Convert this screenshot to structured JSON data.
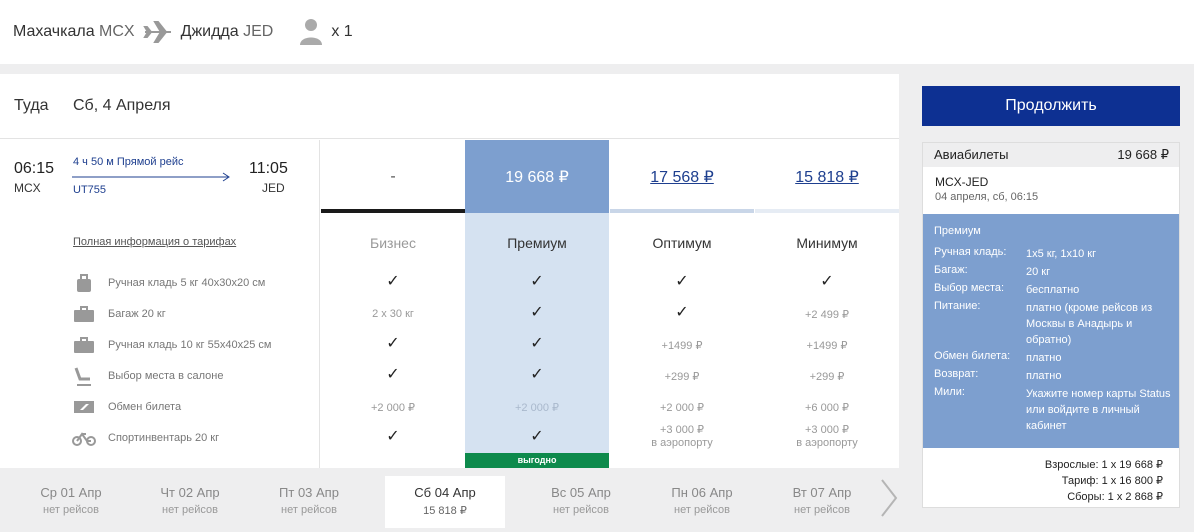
{
  "header": {
    "from_city": "Махачкала",
    "from_code": "MCX",
    "to_city": "Джидда",
    "to_code": "JED",
    "passengers": "x 1"
  },
  "direction": {
    "label": "Туда",
    "date": "Сб, 4 Апреля"
  },
  "flight": {
    "dep_time": "06:15",
    "dep_airport": "MCX",
    "arr_time": "11:05",
    "arr_airport": "JED",
    "duration": "4 ч 50 м  Прямой рейс",
    "number": "UT755"
  },
  "fares": [
    {
      "name": "Бизнес",
      "price": "-"
    },
    {
      "name": "Премиум",
      "price": "19 668 ₽"
    },
    {
      "name": "Оптимум",
      "price": "17 568 ₽"
    },
    {
      "name": "Минимум",
      "price": "15 818 ₽"
    }
  ],
  "full_info_link": "Полная информация о тарифах",
  "features": [
    {
      "label": "Ручная кладь 5 кг 40x30x20 см",
      "icon": "bag-icon",
      "values": [
        "✓",
        "✓",
        "✓",
        "✓"
      ]
    },
    {
      "label": "Багаж 20 кг",
      "icon": "suitcase-icon",
      "values": [
        "2 x 30 кг",
        "✓",
        "✓",
        "+2 499 ₽"
      ]
    },
    {
      "label": "Ручная кладь 10 кг 55x40x25 см",
      "icon": "briefcase-icon",
      "values": [
        "✓",
        "✓",
        "+1499 ₽",
        "+1499 ₽"
      ]
    },
    {
      "label": "Выбор места в салоне",
      "icon": "seat-icon",
      "values": [
        "✓",
        "✓",
        "+299 ₽",
        "+299 ₽"
      ]
    },
    {
      "label": "Обмен билета",
      "icon": "ticket-exchange-icon",
      "values": [
        "+2 000 ₽",
        "+2 000 ₽",
        "+2 000 ₽",
        "+6 000 ₽"
      ]
    },
    {
      "label": "Спортинвентарь 20 кг",
      "icon": "bicycle-icon",
      "values": [
        "✓",
        "✓",
        "+3 000 ₽",
        "+3 000 ₽"
      ],
      "subs": [
        "",
        "",
        "в аэропорту",
        "в аэропорту"
      ]
    }
  ],
  "badge": "выгодно",
  "dates": [
    {
      "name": "Ср 01 Апр",
      "sub": "нет рейсов"
    },
    {
      "name": "Чт 02 Апр",
      "sub": "нет рейсов"
    },
    {
      "name": "Пт 03 Апр",
      "sub": "нет рейсов"
    },
    {
      "name": "Сб 04 Апр",
      "sub": "15 818 ₽"
    },
    {
      "name": "Вс 05 Апр",
      "sub": "нет рейсов"
    },
    {
      "name": "Пн 06 Апр",
      "sub": "нет рейсов"
    },
    {
      "name": "Вт 07 Апр",
      "sub": "нет рейсов"
    }
  ],
  "active_date_index": 3,
  "summary": {
    "continue_label": "Продолжить",
    "tickets_label": "Авиабилеты",
    "tickets_total": "19 668 ₽",
    "route": "MCX-JED",
    "route_date": "04 апреля, сб, 06:15",
    "tariff_name": "Премиум",
    "rows": [
      {
        "k": "Ручная кладь:",
        "v": "1x5 кг, 1x10 кг"
      },
      {
        "k": "Багаж:",
        "v": "20 кг"
      },
      {
        "k": "Выбор места:",
        "v": "бесплатно"
      },
      {
        "k": "Питание:",
        "v": "платно (кроме рейсов из Москвы в Анадырь и обратно)"
      },
      {
        "k": "Обмен билета:",
        "v": "платно"
      },
      {
        "k": "Возврат:",
        "v": "платно"
      },
      {
        "k": "Мили:",
        "v": "Укажите номер карты Status или войдите в личный кабинет"
      }
    ],
    "adults": "Взрослые:  1 x 19 668 ₽",
    "tariff": "Тариф:  1 x 16 800 ₽",
    "fees": "Сборы:  1 x 2 868 ₽"
  },
  "colors": {
    "accent": "#0d3092",
    "link": "#1e3f8f",
    "selected": "#7d9fcf",
    "selected_light": "#d5e2f1",
    "badge": "#0d8a4c"
  }
}
